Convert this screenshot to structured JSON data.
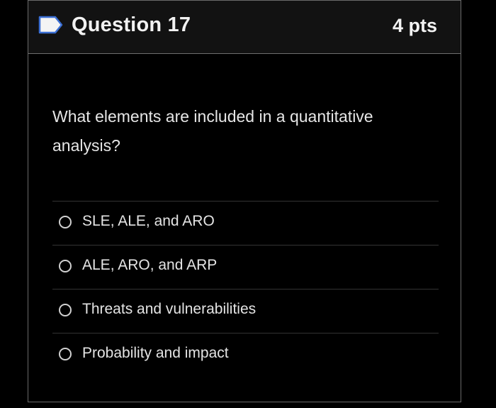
{
  "question": {
    "title": "Question 17",
    "points": "4 pts",
    "flag_icon": "flag-outline-icon",
    "text": "What elements are included in a quantitative analysis?",
    "answers": [
      {
        "label": "SLE, ALE, and ARO",
        "selected": false
      },
      {
        "label": "ALE, ARO, and ARP",
        "selected": false
      },
      {
        "label": "Threats and vulnerabilities",
        "selected": false
      },
      {
        "label": "Probability and impact",
        "selected": false
      }
    ]
  },
  "colors": {
    "background": "#000000",
    "header": "#121212",
    "border": "#6a6a6a",
    "flag_outline": "#3b6fd4",
    "text": "#e6e6e6"
  }
}
